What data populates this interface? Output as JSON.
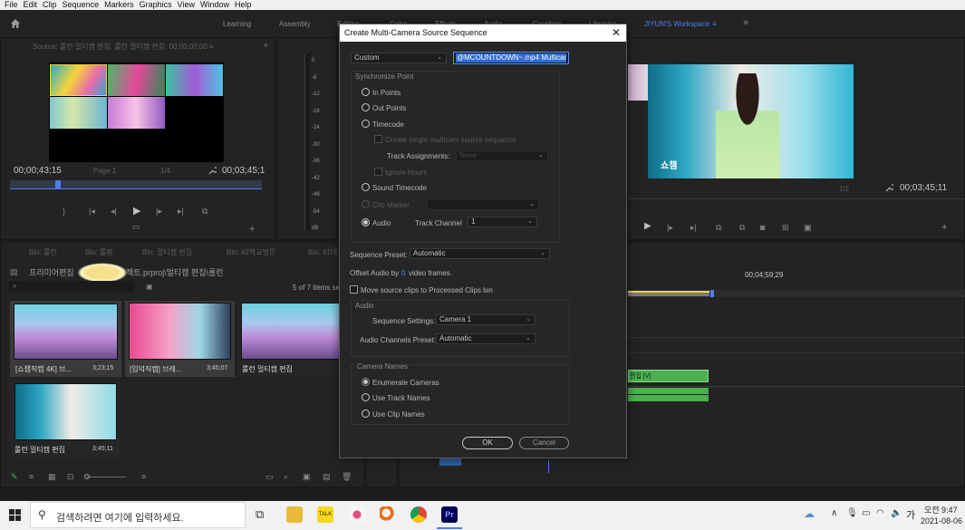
{
  "menubar": {
    "items": [
      "File",
      "Edit",
      "Clip",
      "Sequence",
      "Markers",
      "Graphics",
      "View",
      "Window",
      "Help"
    ]
  },
  "workspaces": {
    "home_icon": "home-icon",
    "tabs": [
      "Learning",
      "Assembly",
      "Editing",
      "Color",
      "Effects",
      "Audio",
      "Graphics",
      "Libraries"
    ],
    "active": "JIYUN'S Workspace",
    "more": "»"
  },
  "source_monitor": {
    "title": "Source: 롤런 멀티캠 편집: 롤런 멀티캠 편집: 00;00;00;00 ≡",
    "timecode_left": "00;00;43;15",
    "page": "Page 1",
    "fraction": "1/4",
    "timecode_right": "00;03;45;1"
  },
  "audio_meter": {
    "ticks": [
      "0",
      "-6",
      "-12",
      "-18",
      "-24",
      "-30",
      "-36",
      "-42",
      "-48",
      "-54",
      "dB"
    ]
  },
  "program_monitor": {
    "overlay_text": "쇼챔",
    "fraction": "1/2",
    "timecode": "00;03;45;11"
  },
  "timeline": {
    "timecode": "00;04;59;29",
    "clip_label": "편집 [V]",
    "clip_color": "#4caf50"
  },
  "bin": {
    "tabs": [
      "Bin: 롤런",
      "Bin: 롤팡",
      "Bin: 멀티캠 편집",
      "Bin: #2학교명문",
      "Bin: #1대"
    ],
    "path_left": "프리미어편집",
    "path_right": "젝트.prproj\\멀티캠 편집\\롤런",
    "count": "5 of 7 items sel",
    "items": [
      {
        "name": "[쇼챔직캠 4K] 브...",
        "duration": "3;23;15"
      },
      {
        "name": "[입덕직캠] 브레...",
        "duration": "3;45;07"
      },
      {
        "name": "롤런 멀티캠 편집",
        "duration": ""
      },
      {
        "name": "롤런 멀티캠 편집",
        "duration": "3;45;11"
      }
    ]
  },
  "dialog": {
    "title": "Create Multi-Camera Source Sequence",
    "close_icon": "close-icon",
    "naming_dropdown": "Custom",
    "name_field": "@MCOUNTDOWN~.mp4 Multicam",
    "sync_title": "Synchronize Point",
    "in_points": "In Points",
    "out_points": "Out Points",
    "timecode": "Timecode",
    "create_single": "Create single multicam source sequence",
    "track_assignments_label": "Track Assignments:",
    "track_assignments_value": "None",
    "ignore_hours": "Ignore Hours",
    "sound_timecode": "Sound Timecode",
    "clip_marker": "Clip Marker",
    "audio": "Audio",
    "track_channel_label": "Track Channel",
    "track_channel_value": "1",
    "sequence_preset_label": "Sequence Preset:",
    "sequence_preset_value": "Automatic",
    "offset_audio_prefix": "Offset Audio by",
    "offset_audio_value": "0",
    "offset_audio_suffix": "video frames.",
    "move_source": "Move source clips to Processed Clips bin",
    "audio_group": "Audio",
    "sequence_settings_label": "Sequence Settings:",
    "sequence_settings_value": "Camera 1",
    "audio_channels_label": "Audio Channels Preset:",
    "audio_channels_value": "Automatic",
    "camera_names_title": "Camera Names",
    "enumerate_cameras": "Enumerate Cameras",
    "use_track_names": "Use Track Names",
    "use_clip_names": "Use Clip Names",
    "ok": "OK",
    "cancel": "Cancel"
  },
  "taskbar": {
    "search_placeholder": "검색하려면 여기에 입력하세요.",
    "ime": "가",
    "time": "오전 9:47",
    "date": "2021-08-06"
  },
  "colors": {
    "accent": "#4f7cf2",
    "dialog_bg": "#262626",
    "panel_bg": "#232323"
  }
}
